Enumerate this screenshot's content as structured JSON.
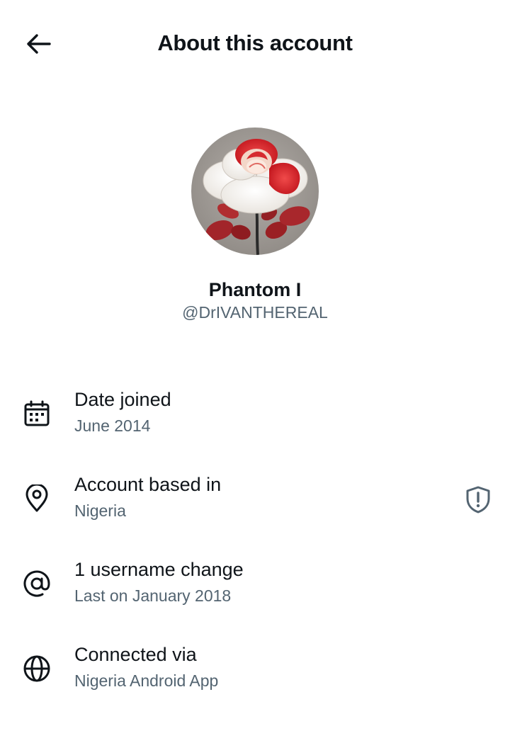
{
  "header": {
    "back_icon": "arrow-left-icon",
    "title": "About this account"
  },
  "profile": {
    "avatar_icon": "rose-avatar-image",
    "display_name": "Phantom I",
    "handle": "@DrIVANTHEREAL"
  },
  "info": {
    "date_joined": {
      "icon": "calendar-icon",
      "label": "Date joined",
      "value": "June 2014"
    },
    "account_based": {
      "icon": "location-pin-icon",
      "label": "Account based in",
      "value": "Nigeria",
      "side_icon": "shield-alert-icon"
    },
    "username_change": {
      "icon": "at-sign-icon",
      "label": "1 username change",
      "value": "Last on January 2018"
    },
    "connected_via": {
      "icon": "globe-icon",
      "label": "Connected via",
      "value": "Nigeria Android App"
    }
  },
  "colors": {
    "text_primary": "#0f1419",
    "text_secondary": "#536471",
    "background": "#ffffff",
    "avatar_background": "#9a958f",
    "rose_red": "#d0202a"
  }
}
